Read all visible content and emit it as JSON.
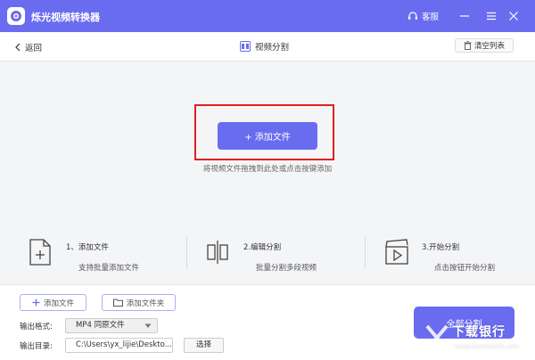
{
  "app": {
    "title": "烁光视频转换器",
    "service_label": "客服"
  },
  "toolbar": {
    "back_label": "返回",
    "page_title": "视频分割",
    "clear_label": "清空列表"
  },
  "dropzone": {
    "add_button": "+ 添加文件",
    "hint": "将视频文件拖拽到此处或点击按键添加"
  },
  "steps": [
    {
      "title": "1、添加文件",
      "subtitle": "支持批量添加文件"
    },
    {
      "title": "2.编辑分割",
      "subtitle": "批量分割多段视频"
    },
    {
      "title": "3.开始分割",
      "subtitle": "点击按钮开始分割"
    }
  ],
  "bottom": {
    "add_file": "添加文件",
    "add_folder": "添加文件夹",
    "format_label": "输出格式:",
    "format_value": "MP4 同原文件",
    "dir_label": "输出目录:",
    "dir_value": "C:\\Users\\yx_lijie\\Deskto...",
    "choose_label": "选择",
    "start_all": "全部分割"
  },
  "watermark": {
    "text": "下载银行",
    "url": "www.downbank.com"
  },
  "colors": {
    "accent": "#6a6cf0",
    "highlight": "#e02020"
  }
}
